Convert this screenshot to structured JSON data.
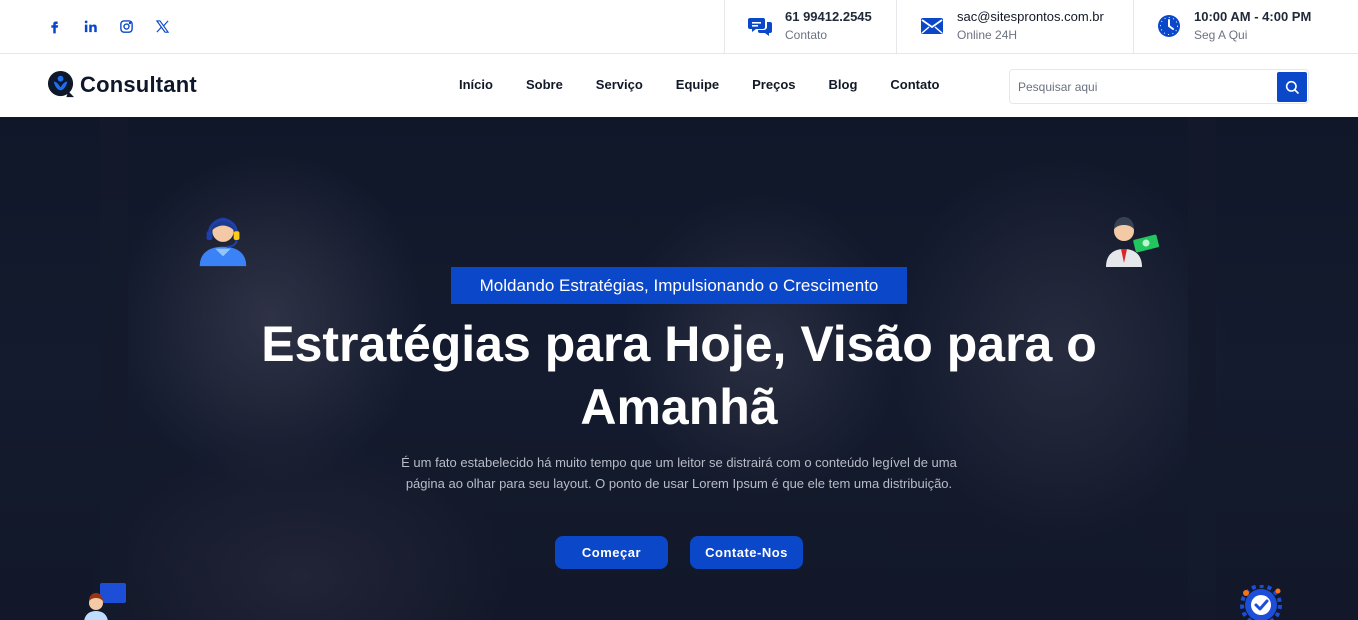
{
  "topbar": {
    "social": [
      "facebook-icon",
      "linkedin-icon",
      "instagram-icon",
      "x-icon"
    ],
    "phone": {
      "value": "61 99412.2545",
      "label": "Contato"
    },
    "email": {
      "value": "sac@sitesprontos.com.br",
      "label": "Online 24H"
    },
    "hours": {
      "value": "10:00 AM - 4:00 PM",
      "label": "Seg A Qui"
    }
  },
  "nav": {
    "logo": "Consultant",
    "items": [
      {
        "label": "Início"
      },
      {
        "label": "Sobre"
      },
      {
        "label": "Serviço"
      },
      {
        "label": "Equipe"
      },
      {
        "label": "Preços"
      },
      {
        "label": "Blog"
      },
      {
        "label": "Contato"
      }
    ],
    "search_placeholder": "Pesquisar aqui"
  },
  "hero": {
    "badge": "Moldando Estratégias, Impulsionando o Crescimento",
    "title": "Estratégias para Hoje, Visão para o Amanhã",
    "text": "É um fato estabelecido há muito tempo que um leitor se distrairá com o conteúdo legível de uma página ao olhar para seu layout. O ponto de usar Lorem Ipsum é que ele tem uma distribuição.",
    "primary_button": "Começar",
    "secondary_button": "Contate-Nos"
  },
  "colors": {
    "accent": "#0b47c9",
    "hero_bg": "#121829",
    "text_dark": "#111827"
  }
}
